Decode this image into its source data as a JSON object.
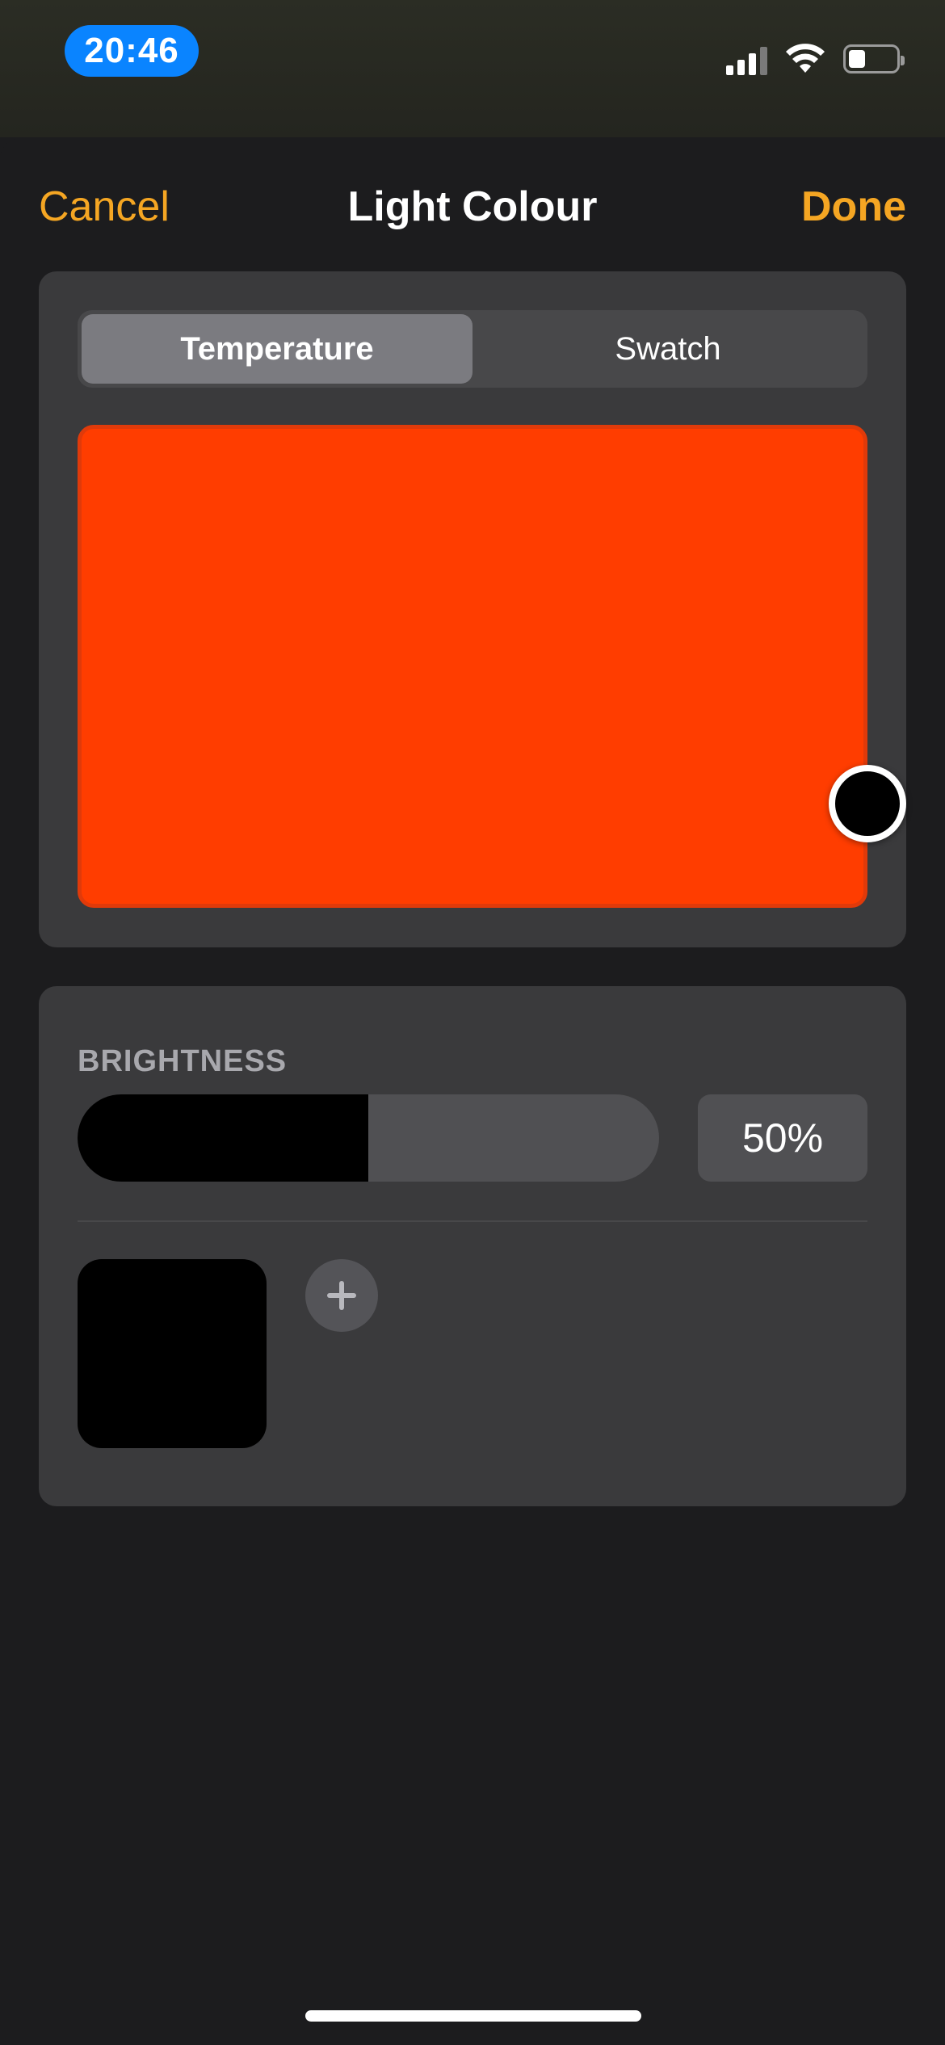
{
  "status_bar": {
    "time": "20:46",
    "icons": [
      "cellular-signal-icon",
      "wifi-icon",
      "battery-icon"
    ],
    "battery_level": 0.35,
    "accent": "#0a84ff"
  },
  "nav": {
    "cancel_label": "Cancel",
    "title": "Light Colour",
    "done_label": "Done",
    "accent": "#f5a623"
  },
  "color_picker": {
    "tabs": [
      {
        "label": "Temperature",
        "selected": true
      },
      {
        "label": "Swatch",
        "selected": false
      }
    ],
    "current_color": "#ff3d00",
    "knob_color": "#000000"
  },
  "brightness": {
    "label": "BRIGHTNESS",
    "value": 0.5,
    "value_text": "50%",
    "fill_color": "#000000"
  },
  "swatches": {
    "items": [
      {
        "color": "#000000"
      }
    ],
    "add_icon": "plus-icon"
  }
}
